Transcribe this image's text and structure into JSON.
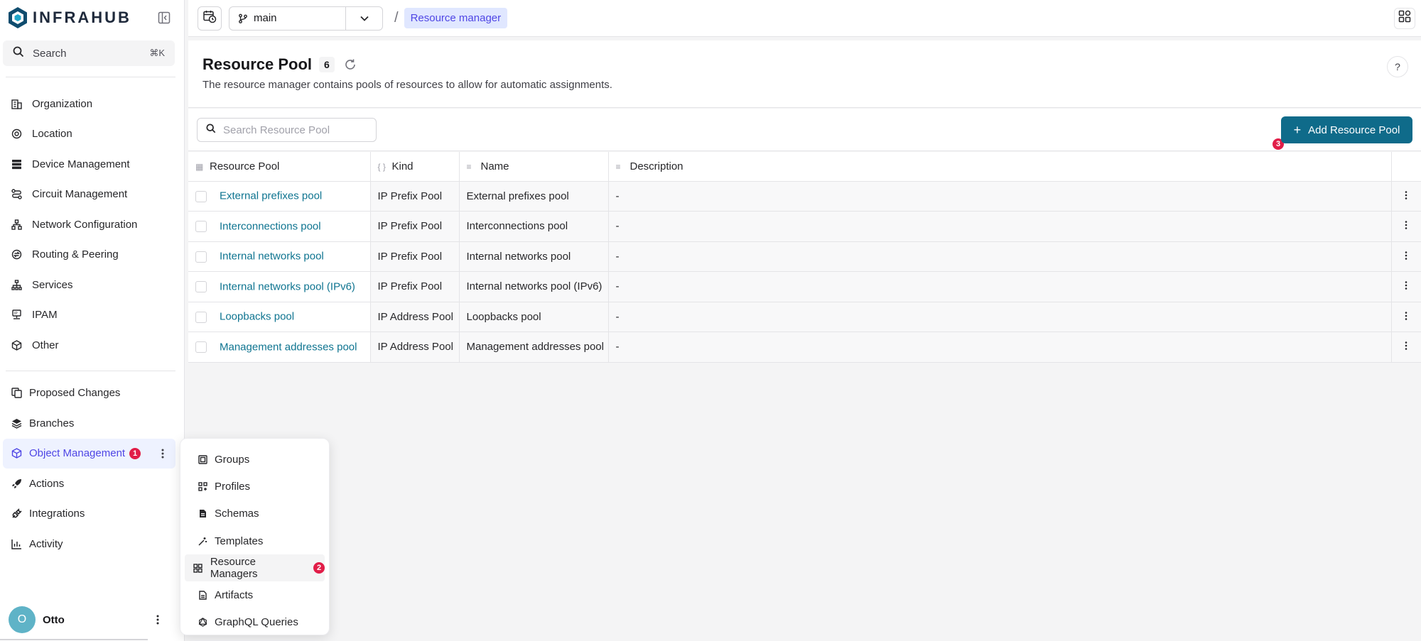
{
  "app": {
    "logo_text": "INFRAHUB"
  },
  "sidebar": {
    "search_label": "Search",
    "search_shortcut": "⌘K",
    "items": [
      {
        "label": "Organization",
        "icon": "building-icon"
      },
      {
        "label": "Location",
        "icon": "map-pin-icon"
      },
      {
        "label": "Device Management",
        "icon": "server-icon"
      },
      {
        "label": "Circuit Management",
        "icon": "route-icon"
      },
      {
        "label": "Network Configuration",
        "icon": "network-icon"
      },
      {
        "label": "Routing & Peering",
        "icon": "routing-icon"
      },
      {
        "label": "Services",
        "icon": "sitemap-icon"
      },
      {
        "label": "IPAM",
        "icon": "ip-icon"
      },
      {
        "label": "Other",
        "icon": "cube-icon"
      }
    ],
    "bottom_items": [
      {
        "label": "Proposed Changes",
        "icon": "diff-icon"
      },
      {
        "label": "Branches",
        "icon": "layers-icon"
      },
      {
        "label": "Object Management",
        "icon": "cube-icon",
        "badge": "1"
      },
      {
        "label": "Actions",
        "icon": "rocket-icon"
      },
      {
        "label": "Integrations",
        "icon": "plug-icon"
      },
      {
        "label": "Activity",
        "icon": "chart-icon"
      }
    ],
    "user": {
      "initial": "O",
      "name": "Otto"
    }
  },
  "topbar": {
    "branch": "main",
    "breadcrumb": "Resource manager"
  },
  "header": {
    "title": "Resource Pool",
    "count": "6",
    "description": "The resource manager contains pools of resources to allow for automatic assignments.",
    "help": "?"
  },
  "toolbar": {
    "search_placeholder": "Search Resource Pool",
    "add_label": "Add Resource Pool",
    "add_badge": "3"
  },
  "table": {
    "columns": [
      "Resource Pool",
      "Kind",
      "Name",
      "Description"
    ],
    "rows": [
      {
        "pool": "External prefixes pool",
        "kind": "IP Prefix Pool",
        "name": "External prefixes pool",
        "description": "-"
      },
      {
        "pool": "Interconnections pool",
        "kind": "IP Prefix Pool",
        "name": "Interconnections pool",
        "description": "-"
      },
      {
        "pool": "Internal networks pool",
        "kind": "IP Prefix Pool",
        "name": "Internal networks pool",
        "description": "-"
      },
      {
        "pool": "Internal networks pool (IPv6)",
        "kind": "IP Prefix Pool",
        "name": "Internal networks pool (IPv6)",
        "description": "-"
      },
      {
        "pool": "Loopbacks pool",
        "kind": "IP Address Pool",
        "name": "Loopbacks pool",
        "description": "-"
      },
      {
        "pool": "Management addresses pool",
        "kind": "IP Address Pool",
        "name": "Management addresses pool",
        "description": "-"
      }
    ]
  },
  "popup_menu": {
    "items": [
      {
        "label": "Groups",
        "icon": "group-icon"
      },
      {
        "label": "Profiles",
        "icon": "profile-icon"
      },
      {
        "label": "Schemas",
        "icon": "file-icon"
      },
      {
        "label": "Templates",
        "icon": "wand-icon"
      },
      {
        "label": "Resource Managers",
        "icon": "grid-icon",
        "badge": "2"
      },
      {
        "label": "Artifacts",
        "icon": "document-icon"
      },
      {
        "label": "GraphQL Queries",
        "icon": "graphql-icon"
      }
    ]
  },
  "colors": {
    "accent": "#0f6b8a",
    "link": "#0e7490",
    "active": "#4f46e5",
    "badge": "#e11d48"
  }
}
